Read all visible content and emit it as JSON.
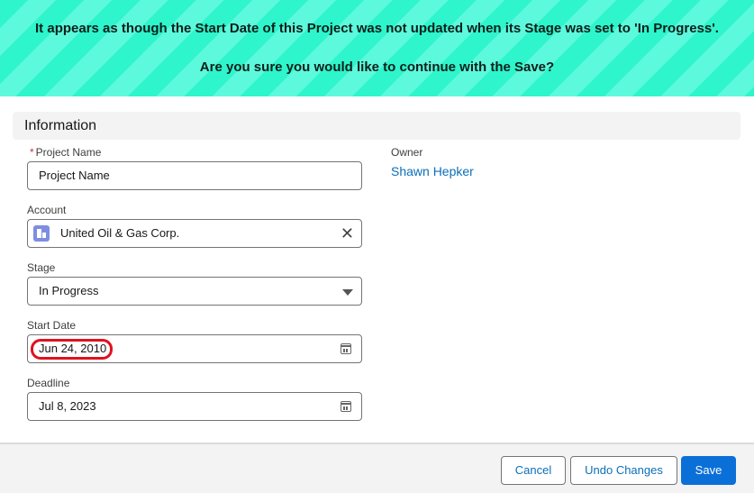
{
  "banner": {
    "line1": "It appears as though the Start Date of this Project was not updated when its Stage was set to 'In Progress'.",
    "line2": "Are you sure you would like to continue with the Save?"
  },
  "section": {
    "title": "Information"
  },
  "form": {
    "project_name": {
      "required_mark": "*",
      "label": "Project Name",
      "value": "Project Name"
    },
    "account": {
      "label": "Account",
      "value": "United Oil & Gas Corp.",
      "clear_glyph": "✕"
    },
    "stage": {
      "label": "Stage",
      "value": "In Progress"
    },
    "start_date": {
      "label": "Start Date",
      "value": "Jun 24, 2010"
    },
    "deadline": {
      "label": "Deadline",
      "value": "Jul 8, 2023"
    },
    "owner": {
      "label": "Owner",
      "value": "Shawn Hepker"
    }
  },
  "footer": {
    "cancel_label": "Cancel",
    "undo_label": "Undo Changes",
    "save_label": "Save"
  },
  "colors": {
    "banner_stripe_a": "#2ef5cc",
    "banner_stripe_b": "#5df9dc",
    "brand_button": "#0b6fd8",
    "link": "#0b6fb8",
    "highlight_ring": "#e0121f",
    "account_icon": "#7f8de1"
  },
  "icons": {
    "account": "account-building-icon",
    "clear": "close-icon",
    "stage": "chevron-down-icon",
    "date": "calendar-icon"
  }
}
